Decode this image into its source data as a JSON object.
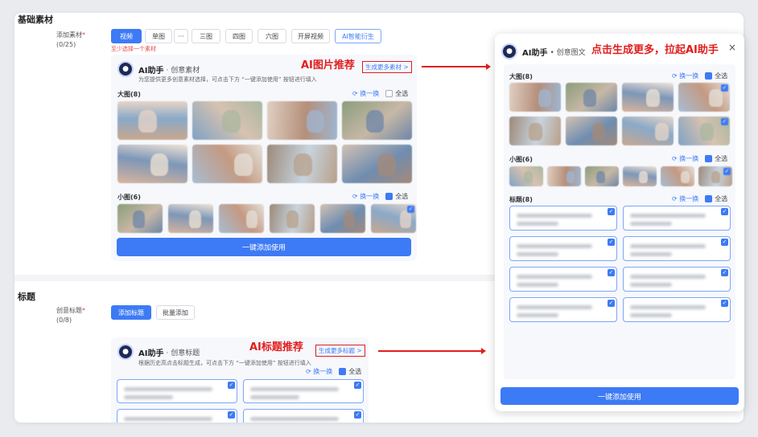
{
  "sections": {
    "material": {
      "title": "基础素材",
      "field_label": "添加素材",
      "field_count": "(0/25)",
      "required_mark": "*",
      "tabs": [
        "视频",
        "单图",
        "···",
        "三图",
        "四图",
        "六图",
        "开屏视频",
        "AI智能衍生"
      ],
      "error": "至少选择一个素材"
    },
    "title_section": {
      "title": "标题",
      "field_label": "创意标题",
      "field_count": "(0/8)",
      "required_mark": "*",
      "add_button": "添加标题",
      "batch_button": "批量添加"
    }
  },
  "material_card": {
    "ai_name": "AI助手",
    "ai_sub": "· 创意素材",
    "desc": "为您提供更多创意素材选择，可点击下方 “一键添加使用” 按钮进行填入",
    "red_label": "AI图片推荐",
    "gen_more": "生成更多素材 >",
    "big_label": "大图(8)",
    "small_label": "小图(6)",
    "refresh": "换一换",
    "select_all": "全选",
    "add_button": "一键添加使用"
  },
  "title_card": {
    "ai_name": "AI助手",
    "ai_sub": "· 创意标题",
    "desc": "根据历史高点击标题生成，可点击下方 “一键添加使用” 按钮进行填入",
    "red_label": "AI标题推荐",
    "gen_more": "生成更多标题 >",
    "refresh": "换一换",
    "select_all": "全选"
  },
  "panel": {
    "ai_name": "AI助手",
    "ai_sub": "• 创意图文",
    "red_label": "点击生成更多，拉起AI助手",
    "close": "×",
    "big_label": "大图(8)",
    "small_label": "小图(6)",
    "title_label": "标题(8)",
    "refresh": "换一换",
    "select_all": "全选",
    "add_button": "一键添加使用"
  },
  "colors": {
    "primary": "#3d7af5",
    "annotation_red": "#e11d1d"
  }
}
